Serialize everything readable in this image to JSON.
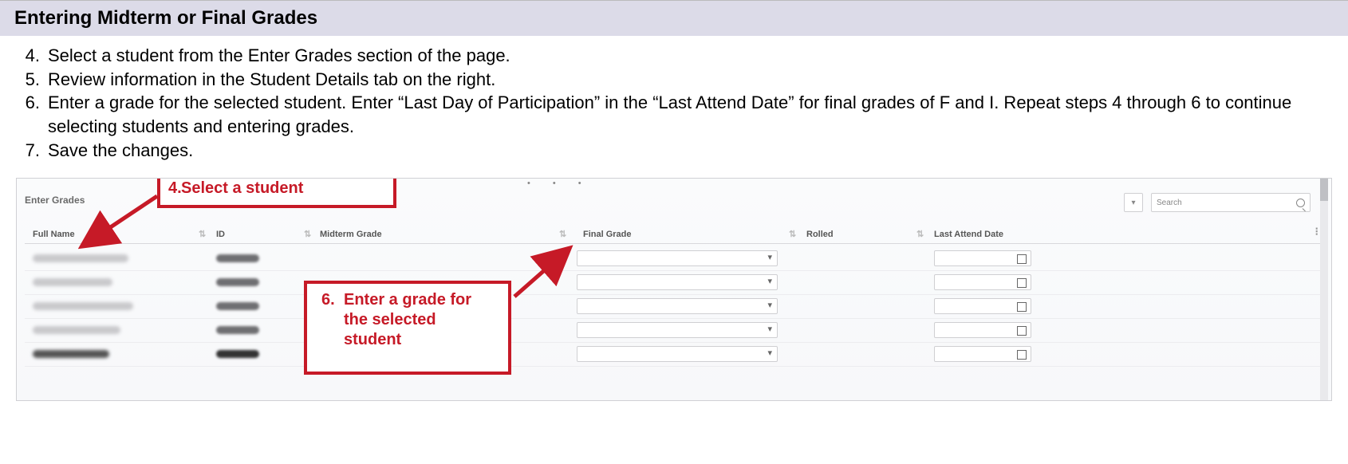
{
  "heading": "Entering Midterm or Final Grades",
  "steps": [
    {
      "num": "4.",
      "text": "Select a student from the Enter Grades section of the page."
    },
    {
      "num": "5.",
      "text": "Review information in the Student Details tab on the right."
    },
    {
      "num": "6.",
      "text": "Enter a grade for the selected student. Enter “Last Day of Participation” in the “Last Attend Date” for final grades of F and I. Repeat steps 4 through 6 to continue selecting students and entering grades."
    },
    {
      "num": "7.",
      "text": "Save the changes."
    }
  ],
  "callouts": {
    "a": {
      "num": "4.",
      "text": "Select a student"
    },
    "b": {
      "num": "6.",
      "text": "Enter a grade for the selected student"
    }
  },
  "screenshot": {
    "section_label": "Enter Grades",
    "search_placeholder": "Search",
    "ruler": [
      "•",
      "•",
      "•"
    ],
    "columns": {
      "name": "Full Name",
      "id": "ID",
      "midterm": "Midterm Grade",
      "final": "Final Grade",
      "rolled": "Rolled",
      "last": "Last Attend Date"
    }
  }
}
